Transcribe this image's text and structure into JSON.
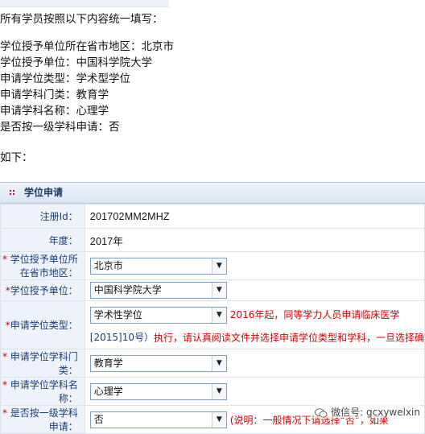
{
  "instructions": {
    "heading": "所有学员按照以下内容统一填写：",
    "lines": [
      "学位授予单位所在省市地区：北京市",
      "学位授予单位：中国科学院大学",
      "申请学位类型：学术型学位",
      "申请学科门类：教育学",
      "申请学科名称：心理学",
      "是否按一级学科申请：否"
    ],
    "as_follows": "如下："
  },
  "panel": {
    "title": "学位申请",
    "rows": {
      "reg_id": {
        "label": "注册Id：",
        "value": "201702MM2MHZ"
      },
      "year": {
        "label": "年度：",
        "value": "2017年"
      },
      "province": {
        "star": "*",
        "label": " 学位授予单位所在省市地区：",
        "value": "北京市"
      },
      "unit": {
        "star": "*",
        "label": "学位授予单位：",
        "value": "中国科学院大学"
      },
      "degree_type": {
        "star": "*",
        "label": "申请学位类型：",
        "value": "学术性学位",
        "note_red": "2016年起，同等学力人员申请临床医学",
        "note_line2_blue": "[2015]10号）",
        "note_line2_red": "执行，请认真阅读文件并选择申请学位类型和学科，一旦选择确"
      },
      "category": {
        "star": "*",
        "label": " 申请学位学科门类：",
        "value": "教育学"
      },
      "discipline": {
        "star": "*",
        "label": " 申请学位学科名称：",
        "value": "心理学"
      },
      "first_level": {
        "star": "*",
        "label": " 是否按一级学科申请：",
        "value": "否",
        "note": "(说明：一般情况下请选择“否”，如果"
      }
    }
  },
  "watermark": {
    "text": "微信号: gcxywelxin"
  },
  "colors": {
    "accent_red": "#d40000",
    "label_blue": "#1a3d78",
    "header_bg": "#d9e5f4"
  }
}
